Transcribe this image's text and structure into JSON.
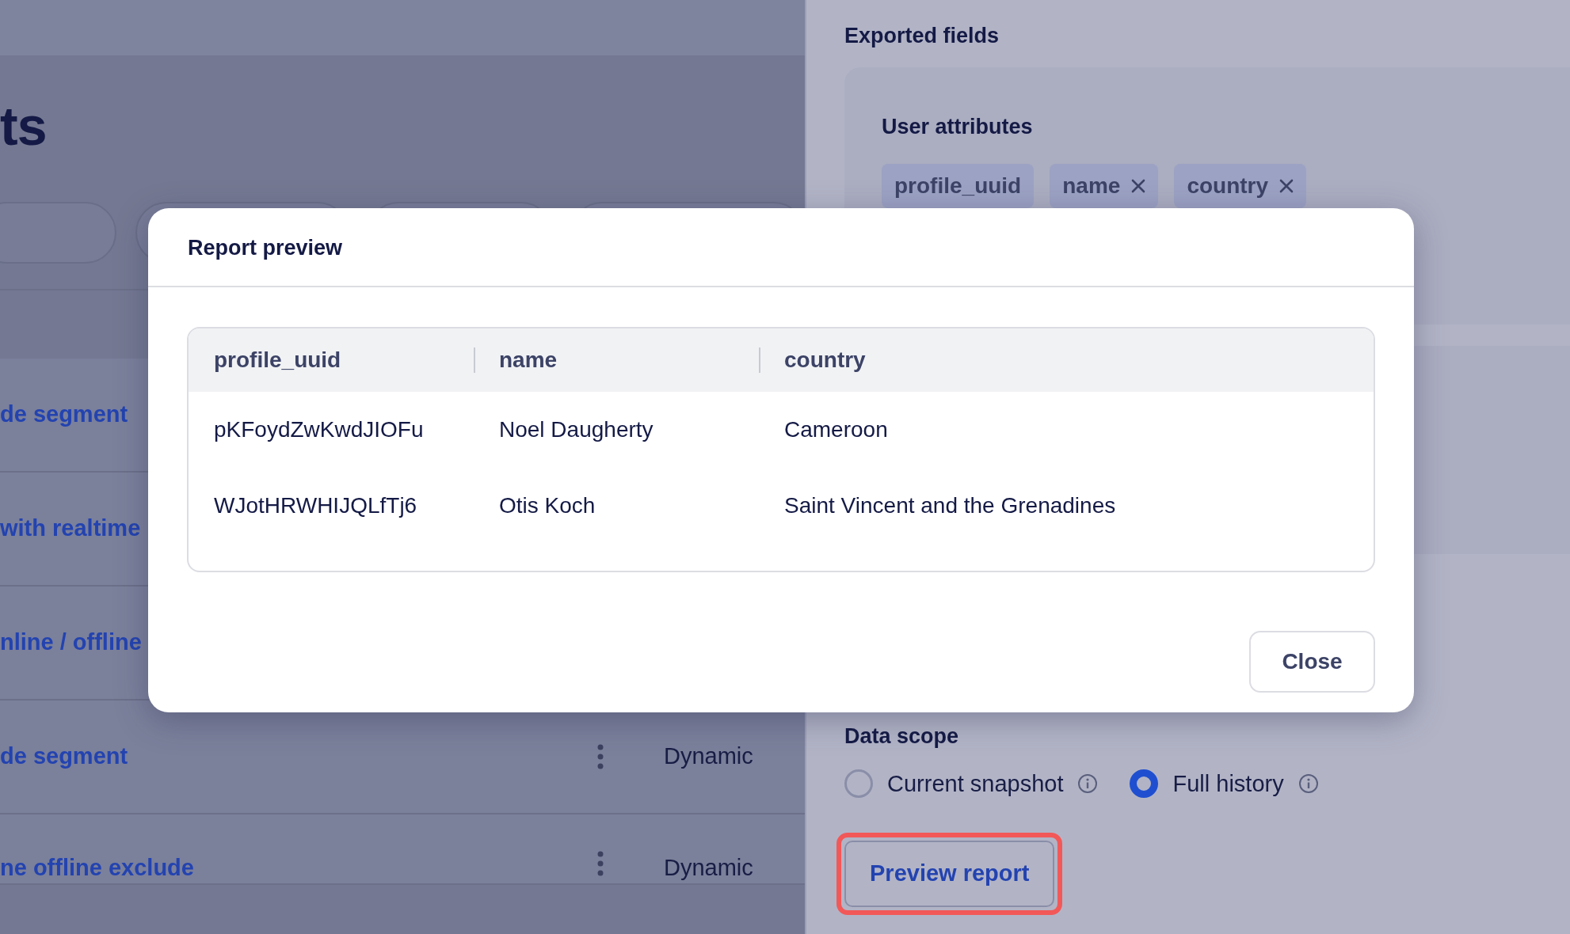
{
  "background_page": {
    "title": "ts",
    "rows": [
      {
        "name": "de segment"
      },
      {
        "name": "with realtime"
      },
      {
        "name": "nline / offline"
      },
      {
        "name": "de segment",
        "type": "Dynamic"
      },
      {
        "name": "ne offline exclude",
        "type": "Dynamic"
      }
    ]
  },
  "export_panel": {
    "title": "Exported fields",
    "group": {
      "title": "User attributes",
      "chips": [
        {
          "label": "profile_uuid",
          "removable": false
        },
        {
          "label": "name",
          "removable": true
        },
        {
          "label": "country",
          "removable": true
        }
      ]
    },
    "data_scope": {
      "title": "Data scope",
      "options": [
        {
          "label": "Current snapshot",
          "selected": false
        },
        {
          "label": "Full history",
          "selected": true
        }
      ]
    },
    "preview_button": {
      "label": "Preview report",
      "highlighted": true
    }
  },
  "modal": {
    "title": "Report preview",
    "table": {
      "columns": [
        "profile_uuid",
        "name",
        "country"
      ],
      "rows": [
        [
          "pKFoydZwKwdJIOFu",
          "Noel Daugherty",
          "Cameroon"
        ],
        [
          "WJotHRWHIJQLfTj6",
          "Otis Koch",
          "Saint Vincent and the Grenadines"
        ]
      ]
    },
    "close_button": "Close"
  }
}
